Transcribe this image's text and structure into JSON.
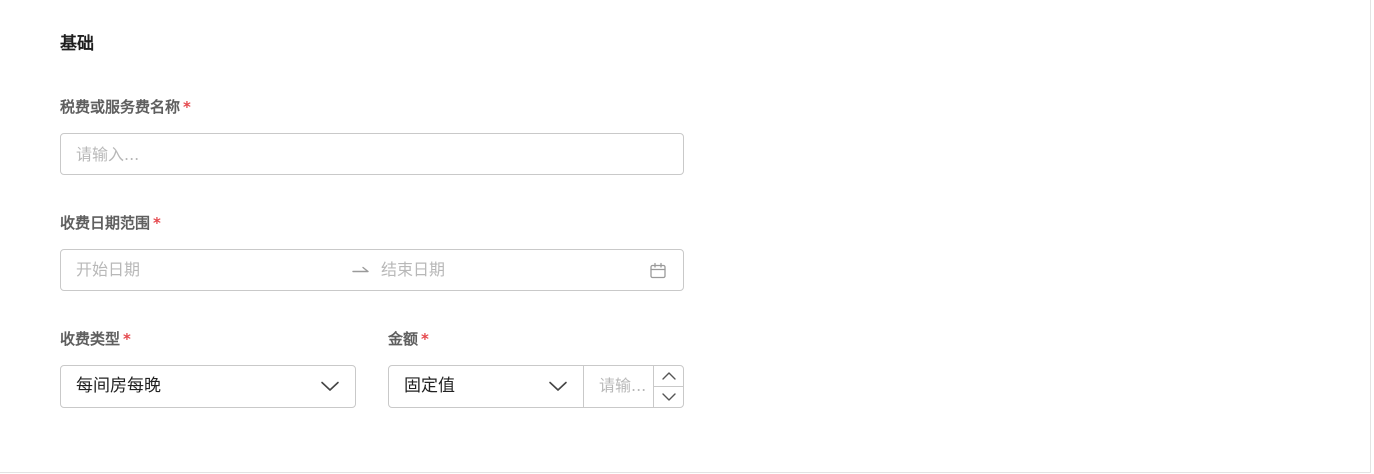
{
  "section": {
    "title": "基础"
  },
  "tax_name": {
    "label": "税费或服务费名称",
    "required_mark": "*",
    "placeholder": "请输入..."
  },
  "date_range": {
    "label": "收费日期范围",
    "required_mark": "*",
    "start_placeholder": "开始日期",
    "separator_icon": "arrow-right-icon",
    "end_placeholder": "结束日期",
    "icon": "calendar-icon"
  },
  "charge_type": {
    "label": "收费类型",
    "required_mark": "*",
    "selected": "每间房每晚",
    "icon": "chevron-down-icon"
  },
  "amount": {
    "label": "金额",
    "required_mark": "*",
    "type_selected": "固定值",
    "value_placeholder": "请输...",
    "icons": [
      "chevron-down-icon",
      "chevron-up-icon",
      "chevron-down-icon"
    ]
  },
  "colors": {
    "required": "#e5484d",
    "border": "#c9c9c9",
    "placeholder": "#b8b8b8",
    "label": "#5f5f5f"
  }
}
